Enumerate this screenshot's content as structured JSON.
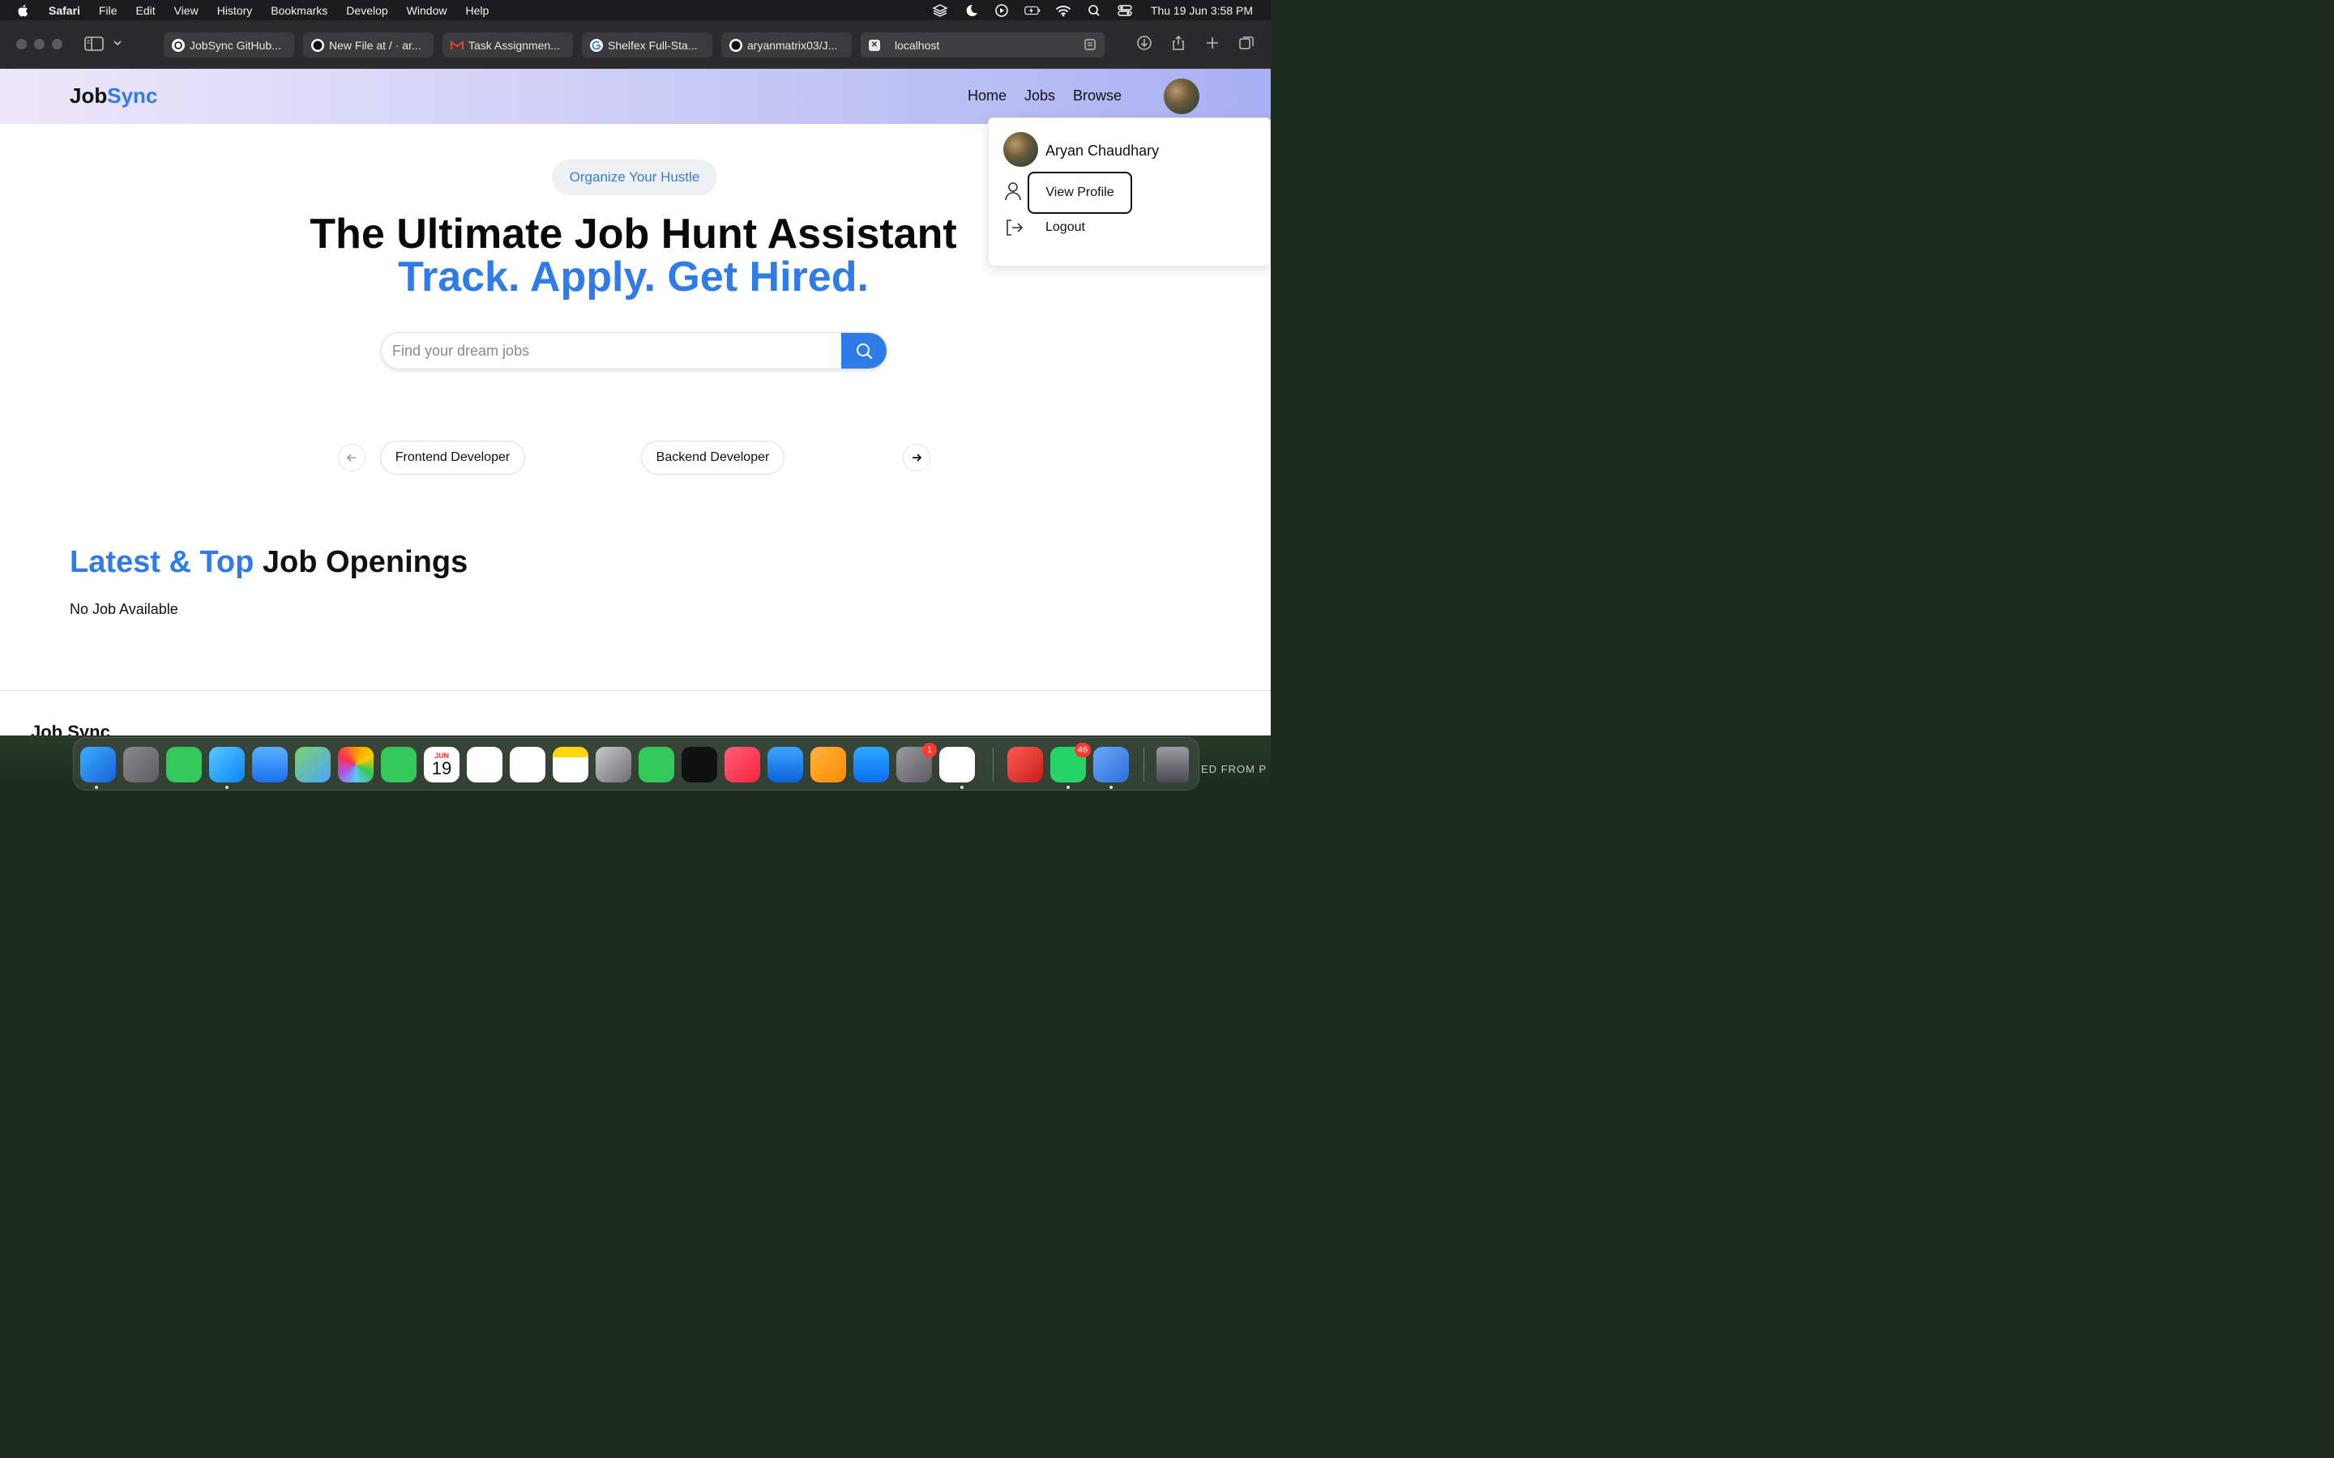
{
  "menubar": {
    "items": [
      "Safari",
      "File",
      "Edit",
      "View",
      "History",
      "Bookmarks",
      "Develop",
      "Window",
      "Help"
    ],
    "clock": "Thu 19 Jun  3:58 PM",
    "status_icons": [
      "layers-icon",
      "moon-icon",
      "play-circle-icon",
      "battery-charging-icon",
      "wifi-icon",
      "search-icon",
      "control-center-icon"
    ]
  },
  "browser": {
    "tabs": [
      {
        "title": "JobSync GitHub...",
        "icon": "openai-icon"
      },
      {
        "title": "New File at / · ar...",
        "icon": "github-icon"
      },
      {
        "title": "Task Assignmen...",
        "icon": "gmail-icon"
      },
      {
        "title": "Shelfex Full-Sta...",
        "icon": "google-icon"
      },
      {
        "title": "aryanmatrix03/J...",
        "icon": "github-icon"
      },
      {
        "title": "localhost",
        "icon": "close-square-icon",
        "active": true
      }
    ]
  },
  "site": {
    "logo_part1": "Job",
    "logo_part2": "Sync",
    "nav": [
      "Home",
      "Jobs",
      "Browse"
    ],
    "badge": "Organize Your Hustle",
    "hero_title": "The Ultimate Job Hunt Assistant",
    "hero_subtitle": "Track. Apply. Get Hired.",
    "search_placeholder": "Find your dream jobs",
    "categories": [
      "Frontend Developer",
      "Backend Developer"
    ],
    "section_title_accent": "Latest & Top",
    "section_title_rest": " Job Openings",
    "empty_message": "No Job Available",
    "footer_logo": "Job Sync"
  },
  "profile_menu": {
    "name": "Aryan Chaudhary",
    "view_profile": "View Profile",
    "logout": "Logout"
  },
  "dock": {
    "badges": {
      "settings": "1",
      "whatsapp": "46"
    },
    "calendar_month": "JUN",
    "calendar_day": "19",
    "watermark": "ED FROM P"
  },
  "colors": {
    "accent": "#2f7ce8",
    "navbar_gradient_start": "#ede7fb",
    "navbar_gradient_end": "#a9b0f3"
  }
}
